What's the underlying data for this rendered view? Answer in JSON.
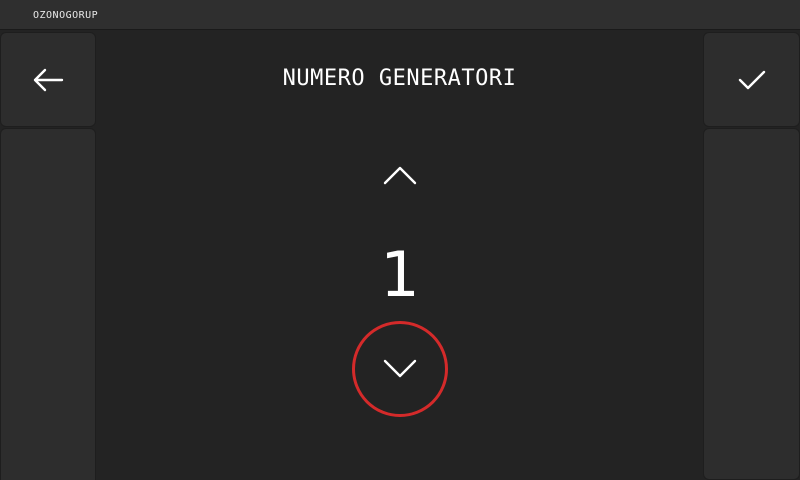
{
  "status_bar": {
    "brand": "OZONOGORUP"
  },
  "header": {
    "title": "NUMERO GENERATORI"
  },
  "stepper": {
    "value": "1"
  },
  "icons": {
    "back": "arrow-left-icon",
    "confirm": "check-icon",
    "increment": "chevron-up-icon",
    "decrement": "chevron-down-icon"
  },
  "colors": {
    "background": "#232323",
    "panel": "#2d2d2d",
    "status_bar": "#2f2f2f",
    "text": "#ffffff",
    "focus_ring": "#d42a2a"
  }
}
